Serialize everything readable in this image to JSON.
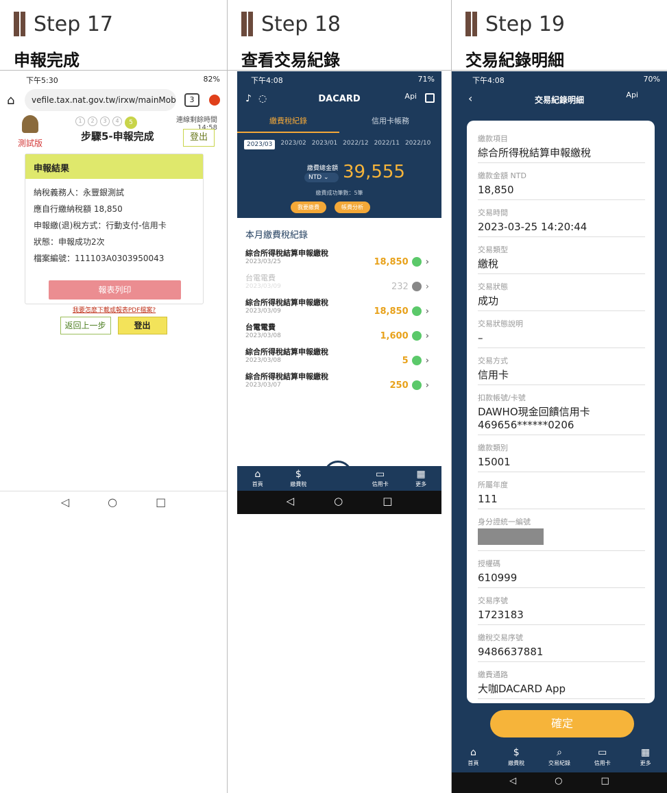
{
  "steps": [
    {
      "label": "Step 17",
      "subtitle": "申報完成"
    },
    {
      "label": "Step 18",
      "subtitle": "查看交易紀錄"
    },
    {
      "label": "Step 19",
      "subtitle": "交易紀錄明細"
    }
  ],
  "col1": {
    "status_time": "下午5:30",
    "status_right": "82%",
    "url": "vefile.tax.nat.gov.tw/irxw/mainMob",
    "tabs_count": "3",
    "test_version": "測試版",
    "step_dots": [
      "1",
      "2",
      "3",
      "4",
      "5"
    ],
    "page_title": "步驟5-申報完成",
    "timer_label": "連線剩餘時間",
    "timer_value": "14:58",
    "logout_top": "登出",
    "result_header": "申報結果",
    "result_lines": [
      "納稅義務人：永豐銀測試",
      "應自行繳納稅額 18,850",
      "申報繳(退)稅方式：行動支付-信用卡",
      "狀態：申報成功2次",
      "檔案編號：111103A0303950043"
    ],
    "print_button": "報表列印",
    "pdf_link": "我要怎麼下載或報表PDF檔案?",
    "back_button": "返回上一步",
    "logout_button": "登出",
    "nav_glyphs": [
      "◁",
      "○",
      "□"
    ]
  },
  "col2": {
    "status_time": "下午4:08",
    "status_right": "71%",
    "app_title": "DACARD",
    "api": "Api",
    "tabs": [
      "繳費稅紀錄",
      "信用卡帳務"
    ],
    "months": [
      "2023/03",
      "2023/02",
      "2023/01",
      "2022/12",
      "2022/11",
      "2022/10"
    ],
    "amount_label": "繳費總金額",
    "currency": "NTD ⌄",
    "total": "39,555",
    "success_count": "繳費成功筆數：5筆",
    "pills": [
      "我要繳費",
      "帳費分析"
    ],
    "records_title": "本月繳費稅紀錄",
    "records": [
      {
        "name": "綜合所得稅結算申報繳稅",
        "date": "2023/03/25",
        "amount": "18,850",
        "ok": true
      },
      {
        "name": "台電電費",
        "date": "2023/03/09",
        "amount": "232",
        "ok": false
      },
      {
        "name": "綜合所得稅結算申報繳稅",
        "date": "2023/03/09",
        "amount": "18,850",
        "ok": true
      },
      {
        "name": "台電電費",
        "date": "2023/03/08",
        "amount": "1,600",
        "ok": true
      },
      {
        "name": "綜合所得稅結算申報繳稅",
        "date": "2023/03/08",
        "amount": "5",
        "ok": true
      },
      {
        "name": "綜合所得稅結算申報繳稅",
        "date": "2023/03/07",
        "amount": "250",
        "ok": true
      }
    ],
    "nav": [
      {
        "glyph": "⌂",
        "label": "首頁"
      },
      {
        "glyph": "$",
        "label": "繳費稅"
      },
      {
        "glyph": "▭",
        "label": "信用卡"
      },
      {
        "glyph": "▦",
        "label": "更多"
      }
    ],
    "nav_glyphs": [
      "◁",
      "○",
      "□"
    ]
  },
  "col3": {
    "status_time": "下午4:08",
    "status_right": "70%",
    "back": "‹",
    "title": "交易紀錄明細",
    "api": "Api",
    "fields": [
      {
        "label": "繳款項目",
        "value": "綜合所得稅結算申報繳稅"
      },
      {
        "label": "繳款金額 NTD",
        "value": "18,850"
      },
      {
        "label": "交易時間",
        "value": "2023-03-25 14:20:44"
      },
      {
        "label": "交易類型",
        "value": "繳稅"
      },
      {
        "label": "交易狀態",
        "value": "成功"
      },
      {
        "label": "交易狀態說明",
        "value": "–"
      },
      {
        "label": "交易方式",
        "value": "信用卡"
      },
      {
        "label": "扣款帳號/卡號",
        "value": "DAWHO現金回饋信用卡",
        "value2": "469656******0206"
      },
      {
        "label": "繳款類別",
        "value": "15001"
      },
      {
        "label": "所屬年度",
        "value": "111"
      },
      {
        "label": "身分證統一編號",
        "value": ""
      },
      {
        "label": "授權碼",
        "value": "610999"
      },
      {
        "label": "交易序號",
        "value": "1723183"
      },
      {
        "label": "繳稅交易序號",
        "value": "9486637881"
      },
      {
        "label": "繳費通路",
        "value": "大咖DACARD App"
      }
    ],
    "confirm": "確定",
    "nav": [
      {
        "glyph": "⌂",
        "label": "首頁"
      },
      {
        "glyph": "$",
        "label": "繳費稅"
      },
      {
        "glyph": "⌕",
        "label": "交易紀錄"
      },
      {
        "glyph": "▭",
        "label": "信用卡"
      },
      {
        "glyph": "▦",
        "label": "更多"
      }
    ],
    "nav_glyphs": [
      "◁",
      "○",
      "□"
    ]
  }
}
